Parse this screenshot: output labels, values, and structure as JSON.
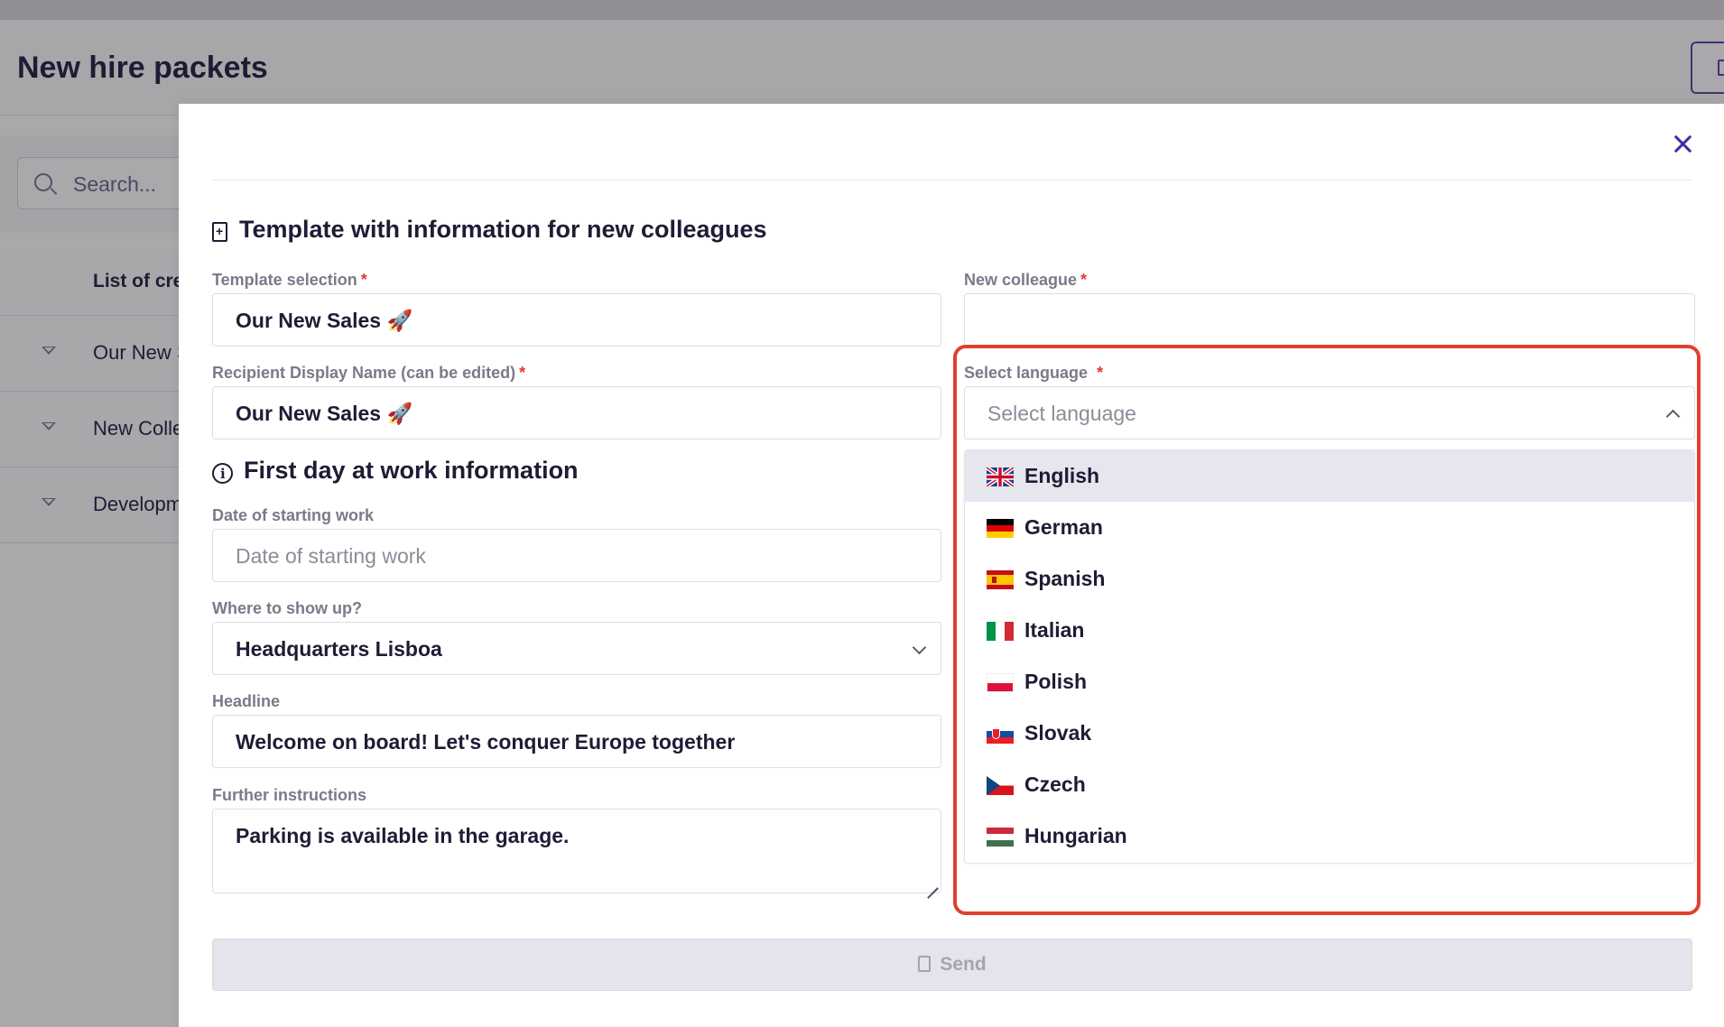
{
  "background": {
    "page_title": "New hire packets",
    "search_placeholder": "Search...",
    "table_header": "List of crea",
    "rows": [
      "Our New S",
      "New Colle",
      "Developm"
    ]
  },
  "modal": {
    "section1_title": "Template with information for new colleagues",
    "template_selection": {
      "label": "Template selection",
      "required": "*",
      "value": "Our New Sales 🚀"
    },
    "recipient_name": {
      "label": "Recipient Display Name (can be edited)",
      "required": "*",
      "value": "Our New Sales 🚀"
    },
    "new_colleague": {
      "label": "New colleague",
      "required": "*",
      "value": ""
    },
    "select_language": {
      "label": "Select language",
      "required": "*",
      "placeholder": "Select language"
    },
    "section2_title": "First day at work information",
    "start_date": {
      "label": "Date of starting work",
      "placeholder": "Date of starting work"
    },
    "location": {
      "label": "Where to show up?",
      "value": "Headquarters Lisboa"
    },
    "headline": {
      "label": "Headline",
      "value": "Welcome on board! Let's conquer Europe together"
    },
    "instructions": {
      "label": "Further instructions",
      "value": "Parking is available in the garage."
    },
    "send_label": "Send"
  },
  "languages": [
    {
      "name": "English",
      "flag": "uk-flag-icon",
      "highlighted": true
    },
    {
      "name": "German",
      "flag": "germany-flag-icon"
    },
    {
      "name": "Spanish",
      "flag": "spain-flag-icon"
    },
    {
      "name": "Italian",
      "flag": "italy-flag-icon"
    },
    {
      "name": "Polish",
      "flag": "poland-flag-icon"
    },
    {
      "name": "Slovak",
      "flag": "slovakia-flag-icon"
    },
    {
      "name": "Czech",
      "flag": "czech-flag-icon"
    },
    {
      "name": "Hungarian",
      "flag": "hungary-flag-icon"
    }
  ],
  "colors": {
    "accent": "#3a2fa8",
    "highlight_border": "#e0402e",
    "required_star": "#e0393b",
    "active_option_bg": "#e6e6ee"
  }
}
